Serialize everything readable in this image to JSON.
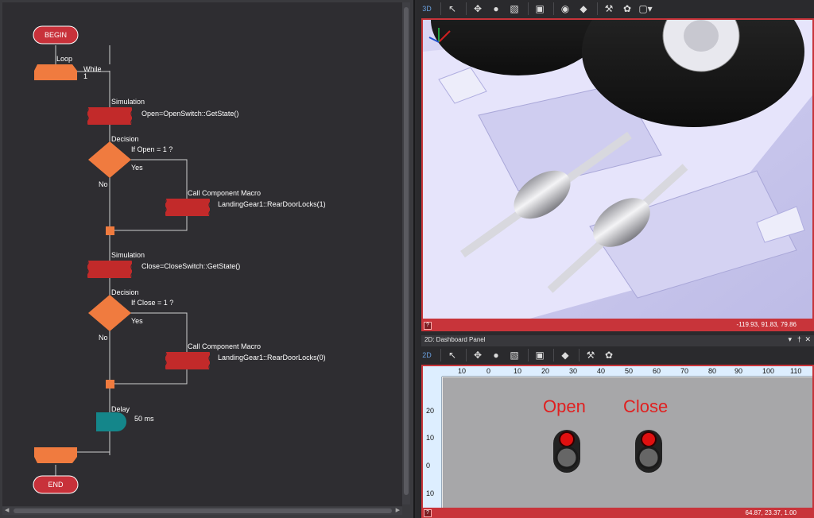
{
  "flowchart": {
    "begin": "BEGIN",
    "end": "END",
    "loop": {
      "label": "Loop",
      "kind": "While",
      "condition": "1"
    },
    "sim1": {
      "label": "Simulation",
      "expr": "Open=OpenSwitch::GetState()"
    },
    "dec1": {
      "label": "Decision",
      "cond": "If Open = 1 ?",
      "yes": "Yes",
      "no": "No"
    },
    "call1": {
      "label": "Call Component Macro",
      "expr": "LandingGear1::RearDoorLocks(1)"
    },
    "sim2": {
      "label": "Simulation",
      "expr": "Close=CloseSwitch::GetState()"
    },
    "dec2": {
      "label": "Decision",
      "cond": "If Close = 1 ?",
      "yes": "Yes",
      "no": "No"
    },
    "call2": {
      "label": "Call Component Macro",
      "expr": "LandingGear1::RearDoorLocks(0)"
    },
    "delay": {
      "label": "Delay",
      "value": "50 ms"
    }
  },
  "panel3d": {
    "tag": "3D",
    "coords": "-119.93, 91.83, 79.86"
  },
  "panel2d": {
    "title": "2D: Dashboard Panel",
    "tag": "2D",
    "coords": "64.87, 23.37, 1.00",
    "open_label": "Open",
    "close_label": "Close",
    "open_led": "on",
    "close_led": "on"
  },
  "ruler": {
    "top_ticks": [
      "10",
      "0",
      "10",
      "20",
      "30",
      "40",
      "50",
      "60",
      "70",
      "80",
      "90",
      "100",
      "110"
    ],
    "left_ticks": [
      "20",
      "10",
      "0",
      "10"
    ]
  },
  "icons": {
    "toolbar": [
      "pointer-icon",
      "move-icon",
      "sphere-icon",
      "image-icon",
      "panel-icon",
      "ball-icon",
      "cube-icon",
      "wrench-icon",
      "palette-icon",
      "frame-icon"
    ]
  },
  "colors": {
    "start_end": "#c8313a",
    "io_block": "#f07b3f",
    "macro_block": "#c22a2a",
    "delay_block": "#14868a",
    "view_border": "#c8343a"
  }
}
